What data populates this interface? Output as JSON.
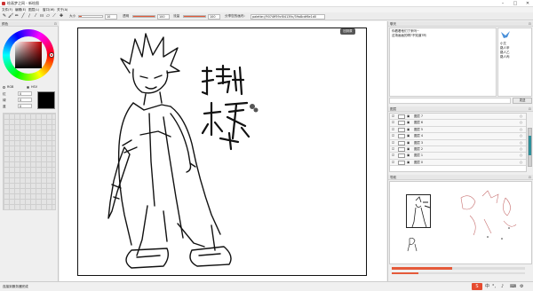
{
  "window": {
    "title": "绘画梦之网 - 新绘图",
    "controls": [
      "–",
      "□",
      "✕"
    ]
  },
  "menu": [
    "文件(F)",
    "编辑(E)",
    "图层(L)",
    "窗口(W)",
    "关于(A)"
  ],
  "toolbar": {
    "size_label": "大小",
    "size_value": "10",
    "opacity_label": "透明",
    "opacity_value": "100",
    "flow_label": "流量",
    "flow_value": "100",
    "room_label": "分享您的画布:",
    "room_value": "palette://9074ff59cf04139c/39a8cdf6e1d0"
  },
  "color_panel": {
    "header": "颜色",
    "pin": "⊡",
    "mode_a": "RGB",
    "mode_b": "HSV",
    "r_label": "红",
    "g_label": "绿",
    "b_label": "蓝",
    "r_value": "0",
    "g_value": "0",
    "b_value": "0",
    "current_color": "#000000"
  },
  "canvas": {
    "reset_label": "回到原"
  },
  "chat": {
    "header": "聊天",
    "pin": "⊡",
    "messages": [
      "你看看他们了来吗~",
      "这场画画的啊?不知道?吗"
    ],
    "users": [
      "小艾",
      "路人甲",
      "路人乙",
      "路人丙"
    ],
    "send_label": "发送"
  },
  "layers": {
    "header": "图层",
    "pin": "⊡",
    "items": [
      {
        "name": "图层 7"
      },
      {
        "name": "图层 6"
      },
      {
        "name": "图层 5"
      },
      {
        "name": "图层 4"
      },
      {
        "name": "图层 3"
      },
      {
        "name": "图层 2"
      },
      {
        "name": "图层 1"
      },
      {
        "name": "图层 0"
      }
    ]
  },
  "navigator": {
    "header": "导航",
    "pin": "⊡",
    "zoom_fraction": 0.45
  },
  "status": {
    "text": "连接到服务器完成"
  },
  "colors": {
    "accent": "#e45a3a",
    "brand": "#4a90d9"
  }
}
